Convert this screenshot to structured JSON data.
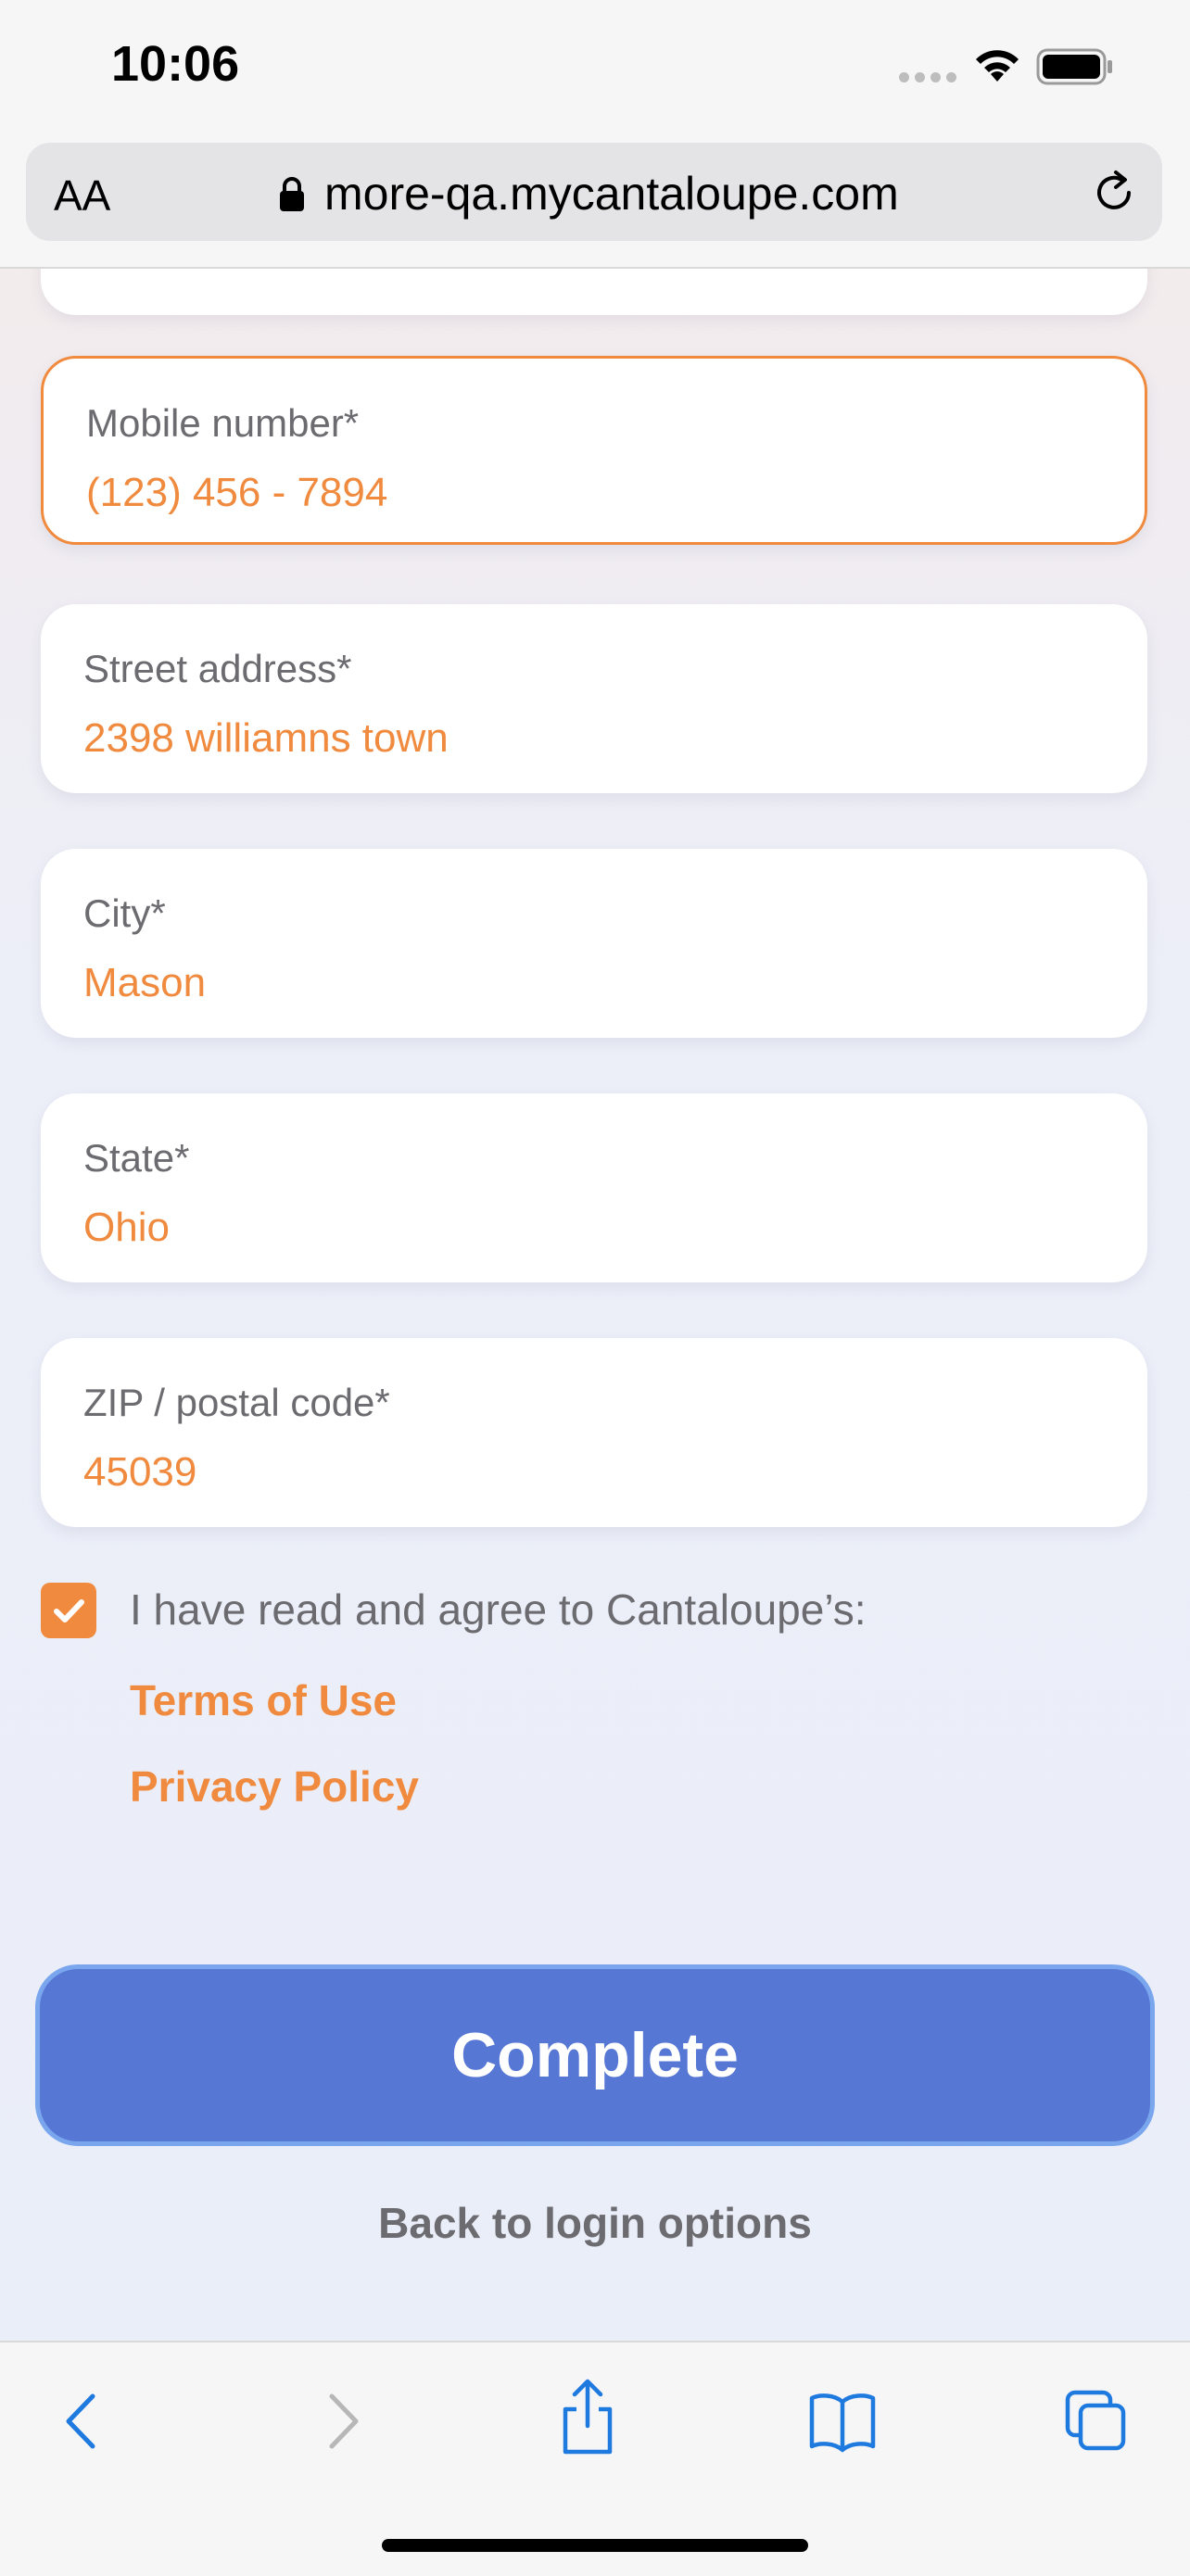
{
  "status_bar": {
    "time": "10:06"
  },
  "browser": {
    "text_size_label": "AA",
    "url": "more-qa.mycantaloupe.com"
  },
  "form": {
    "fields": [
      {
        "label": "Mobile number*",
        "value": "(123) 456 - 7894"
      },
      {
        "label": "Street address*",
        "value": "2398 williamns town"
      },
      {
        "label": "City*",
        "value": "Mason"
      },
      {
        "label": "State*",
        "value": "Ohio"
      },
      {
        "label": "ZIP / postal code*",
        "value": "45039"
      }
    ],
    "agreement_text": "I have read and agree to Cantaloupe’s:",
    "terms_link": "Terms of Use",
    "privacy_link": "Privacy Policy",
    "agreement_checked": true,
    "complete_label": "Complete",
    "back_label": "Back to login options"
  },
  "colors": {
    "accent": "#f08a3e",
    "primary_button": "#5777d4",
    "ios_blue": "#1f7ae0"
  },
  "toolbar": {
    "icons": [
      "back-icon",
      "forward-icon",
      "share-icon",
      "bookmarks-icon",
      "tabs-icon"
    ]
  }
}
